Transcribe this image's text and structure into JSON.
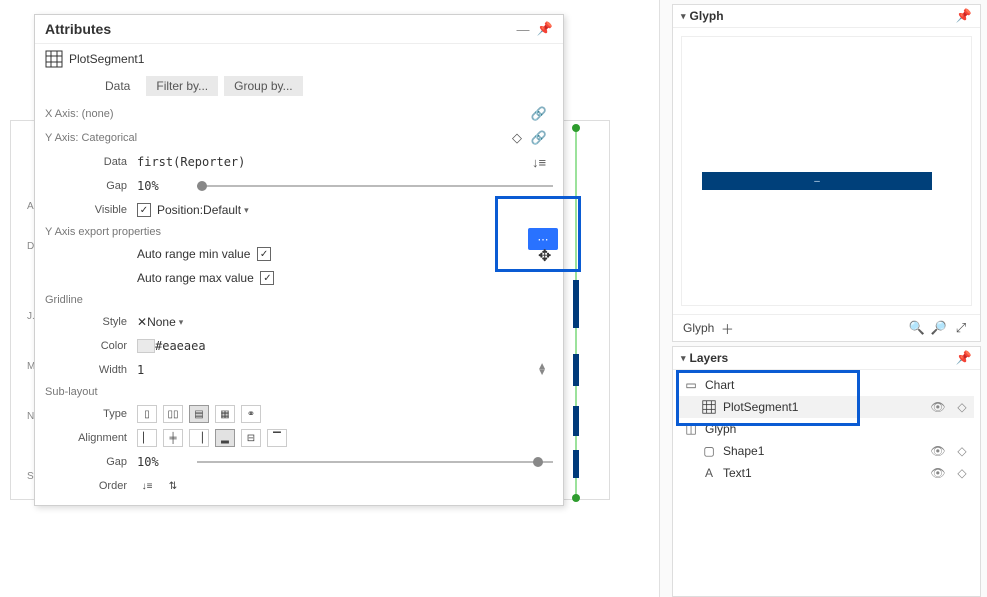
{
  "attributes": {
    "panel_title": "Attributes",
    "object_name": "PlotSegment1",
    "tabs": {
      "data": "Data",
      "filter": "Filter by...",
      "group": "Group by..."
    },
    "xaxis_title": "X Axis: (none)",
    "yaxis_title": "Y Axis: Categorical",
    "yaxis_data_label": "Data",
    "yaxis_data_value": "first(Reporter)",
    "gap_label": "Gap",
    "gap_value": "10%",
    "visible_label": "Visible",
    "position_label": "Position:",
    "position_value": "Default",
    "export_title": "Y Axis export properties",
    "auto_min_label": "Auto range min value",
    "auto_max_label": "Auto range max value",
    "gridline_title": "Gridline",
    "style_label": "Style",
    "style_value": "None",
    "color_label": "Color",
    "color_value": "#eaeaea",
    "width_label": "Width",
    "width_value": "1",
    "sublayout_title": "Sub-layout",
    "type_label": "Type",
    "align_label": "Alignment",
    "subgap_label": "Gap",
    "subgap_value": "10%",
    "order_label": "Order"
  },
  "canvas_labels": [
    "Am.",
    "D",
    "J.",
    "Mar",
    "Nic.",
    "Ste"
  ],
  "glyph": {
    "panel_title": "Glyph",
    "bar_text": "–",
    "footer_label": "Glyph"
  },
  "layers": {
    "panel_title": "Layers",
    "chart": "Chart",
    "plotsegment": "PlotSegment1",
    "glyph": "Glyph",
    "shape": "Shape1",
    "text": "Text1"
  }
}
